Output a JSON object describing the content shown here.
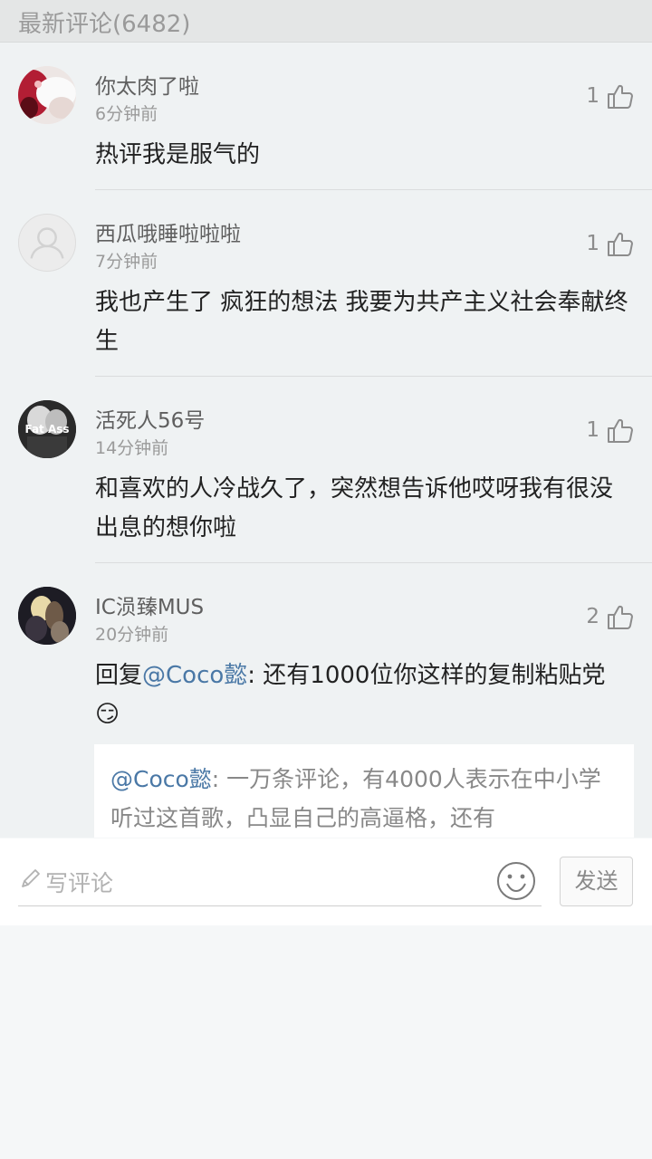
{
  "header": {
    "title": "最新评论(6482)"
  },
  "comments": [
    {
      "username": "你太肉了啦",
      "time": "6分钟前",
      "likes": "1",
      "text": "热评我是服气的",
      "avatar_icon": "red-pink-photo-avatar"
    },
    {
      "username": "西瓜哦睡啦啦啦",
      "time": "7分钟前",
      "likes": "1",
      "text": "我也产生了 疯狂的想法  我要为共产主义社会奉献终生",
      "avatar_icon": "default-user-avatar"
    },
    {
      "username": "活死人56号",
      "time": "14分钟前",
      "likes": "1",
      "text": "和喜欢的人冷战久了，突然想告诉他哎呀我有很没出息的想你啦",
      "avatar_icon": "fat-ass-avatar",
      "avatar_text": "Fat Ass"
    },
    {
      "username": "IC涢臻MUS",
      "time": "20分钟前",
      "likes": "2",
      "reply_prefix": "回复",
      "reply_mention": "@Coco懿",
      "reply_text": ": 还有1000位你这样的复制粘贴党",
      "emoji": "😏",
      "quote_mention": "@Coco懿",
      "quote_text": ": 一万条评论，有4000人表示在中小学听过这首歌，凸显自己的高逼格，还有",
      "avatar_icon": "anime-photo-avatar"
    }
  ],
  "input": {
    "placeholder": "写评论",
    "send_label": "发送"
  },
  "icons": {
    "like": "thumbs-up-icon",
    "edit": "pencil-icon",
    "emoji": "smiley-icon"
  },
  "colors": {
    "mention": "#4a78a6",
    "header_bg": "#e4e6e6",
    "list_bg": "#eff2f3"
  }
}
